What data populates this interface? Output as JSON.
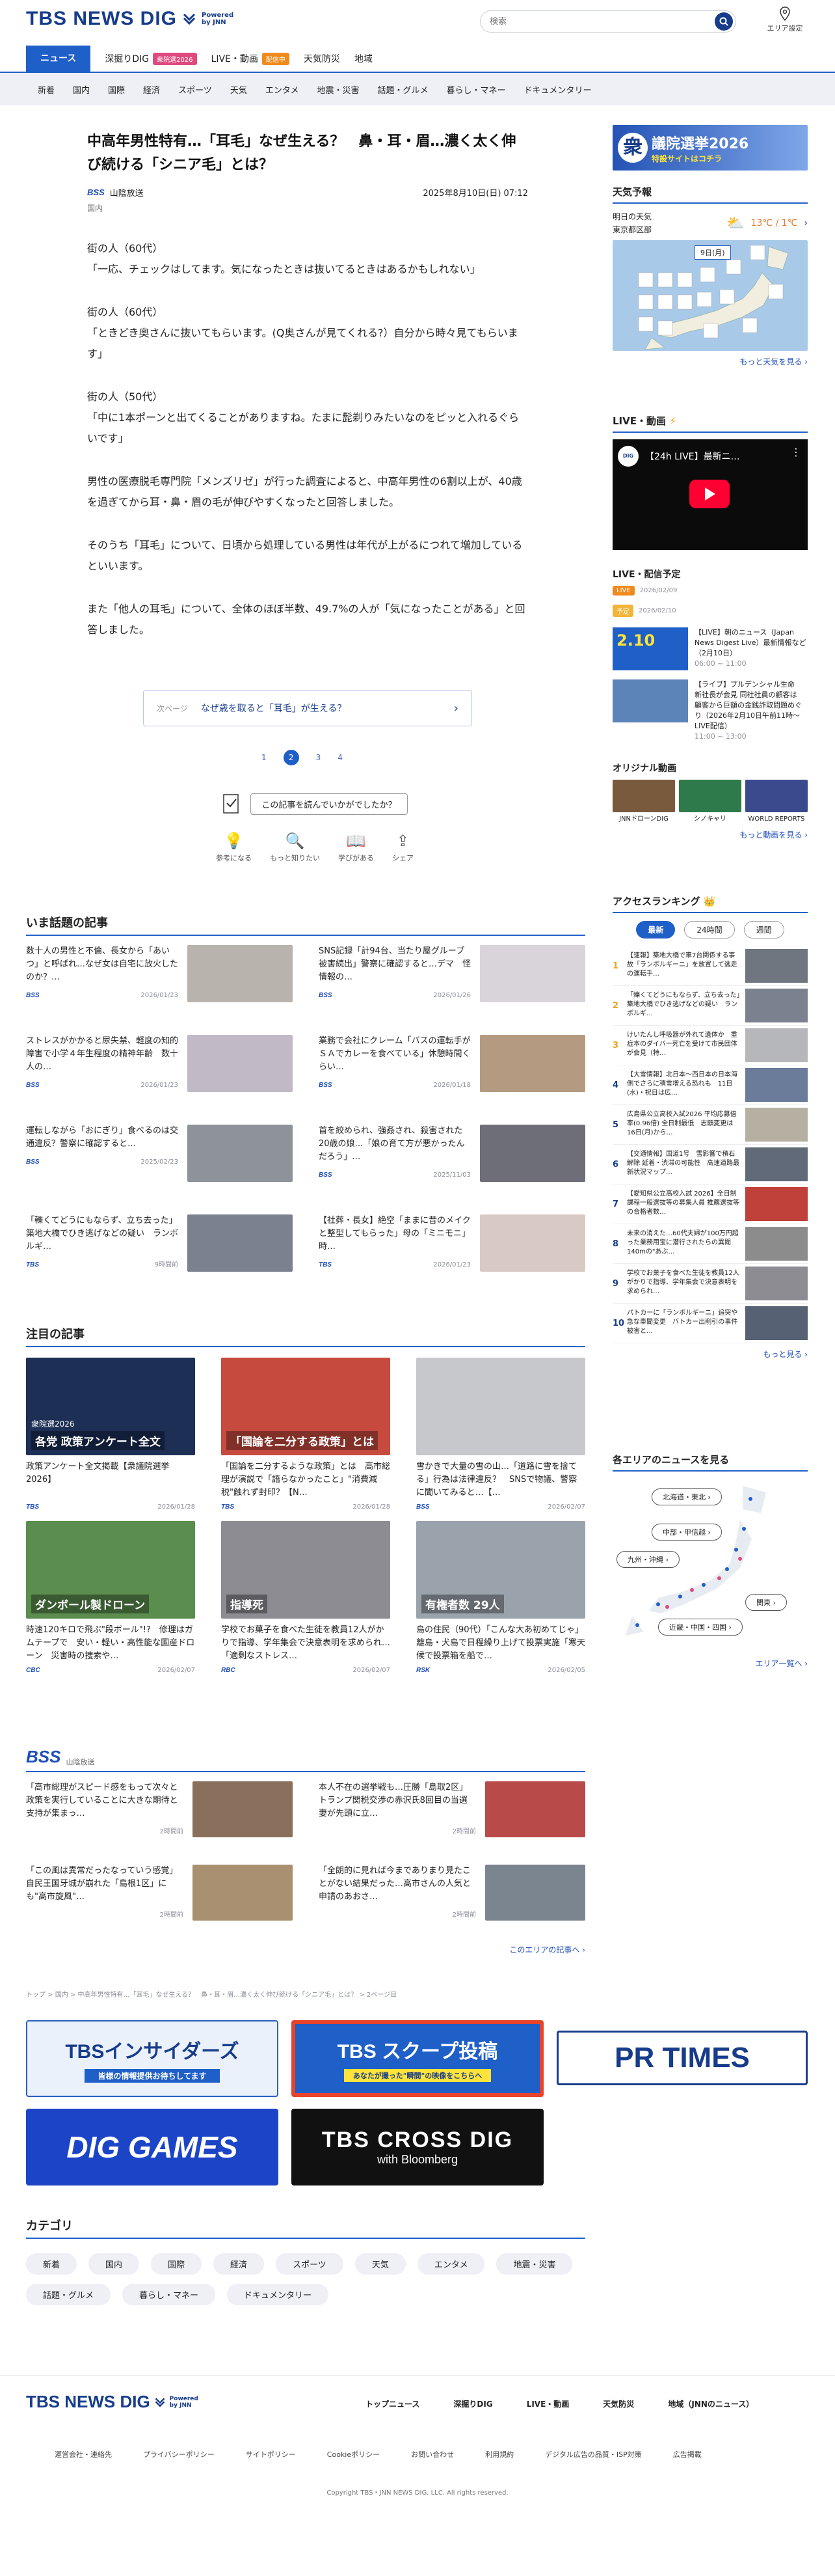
{
  "header": {
    "logo": "TBS NEWS DIG",
    "powered": "Powered",
    "by": "by JNN",
    "search_placeholder": "検索",
    "area_label": "エリア設定"
  },
  "nav_main": [
    {
      "label": "ニュース",
      "active": true
    },
    {
      "label": "深掘りDIG",
      "tag": "衆院選2026",
      "tag_color": "#e0497e"
    },
    {
      "label": "LIVE・動画",
      "tag": "配信中",
      "tag_color": "#f08a1c"
    },
    {
      "label": "天気防災"
    },
    {
      "label": "地域"
    }
  ],
  "nav_sub": [
    "新着",
    "国内",
    "国際",
    "経済",
    "スポーツ",
    "天気",
    "エンタメ",
    "地震・災害",
    "話題・グルメ",
    "暮らし・マネー",
    "ドキュメンタリー"
  ],
  "article": {
    "title": "中高年男性特有…「耳毛」なぜ生える？　鼻・耳・眉…濃く太く伸び続ける「シニア毛」とは？",
    "source_logo": "BSS",
    "source": "山陰放送",
    "date": "2025年8月10日(日) 07:12",
    "category": "国内",
    "paragraphs": [
      "街の人（60代）\n「一応、チェックはしてます。気になったときは抜いてるときはあるかもしれない」",
      "街の人（60代）\n「ときどき奥さんに抜いてもらいます。(Q奥さんが見てくれる?）自分から時々見てもらいます」",
      "街の人（50代）\n「中に1本ポーンと出てくることがありますね。たまに髭剃りみたいなのをピッと入れるぐらいです」",
      "男性の医療脱毛専門院「メンズリゼ」が行った調査によると、中高年男性の6割以上が、40歳を過ぎてから耳・鼻・眉の毛が伸びやすくなったと回答しました。",
      "そのうち「耳毛」について、日頃から処理している男性は年代が上がるにつれて増加しているといいます。",
      "また「他人の耳毛」について、全体のほぼ半数、49.7%の人が「気になったことがある」と回答しました。"
    ],
    "next_label": "次ページ",
    "next_title": "なぜ歳を取ると「耳毛」が生える？",
    "pages": [
      "1",
      "2",
      "3",
      "4"
    ],
    "current_page": "2",
    "rating_question": "この記事を読んでいかがでしたか？",
    "rating_buttons": [
      "参考になる",
      "もっと知りたい",
      "学びがある",
      "シェア"
    ]
  },
  "trending": {
    "title": "いま話題の記事",
    "items": [
      {
        "text": "数十人の男性と不倫、長女から「あいつ」と呼ばれ…なぜ女は自宅に放火したのか？…",
        "src": "BSS",
        "date": "2026/01/23",
        "thumb": "#b9b3ad"
      },
      {
        "text": "SNS記録「計94台、当たり屋グループ被害続出」警察に確認すると…デマ　怪情報の…",
        "src": "BSS",
        "date": "2026/01/26",
        "thumb": "#d8d4d9"
      },
      {
        "text": "ストレスがかかると尿失禁、軽度の知的障害で小学４年生程度の精神年齢　数十人の…",
        "src": "BSS",
        "date": "2026/01/23",
        "thumb": "#c2b9c6"
      },
      {
        "text": "業務で会社にクレーム「バスの運転手がＳＡでカレーを食べている」休憩時間くらい…",
        "src": "BSS",
        "date": "2026/01/18",
        "thumb": "#b59a82"
      },
      {
        "text": "運転しながら「おにぎり」食べるのは交通違反？警察に確認すると…",
        "src": "BSS",
        "date": "2025/02/23",
        "thumb": "#8e9299"
      },
      {
        "text": "首を絞められ、強姦され、殺害された20歳の娘…「娘の育て方が悪かったんだろう」…",
        "src": "BSS",
        "date": "2025/11/03",
        "thumb": "#6d6e77"
      },
      {
        "text": "「轢くてどうにもならず、立ち去った」築地大橋でひき逃げなどの疑い　ランボルギ…",
        "src": "TBS",
        "date": "9時間前",
        "thumb": "#7c8190"
      },
      {
        "text": "【社葬・長女】絶空「ままに昔のメイクと整型してもらった」母の「ミニモニ」時…",
        "src": "TBS",
        "date": "2026/01/23",
        "thumb": "#d9c9c4"
      }
    ]
  },
  "featured": {
    "title": "注目の記事",
    "items": [
      {
        "text": "政策アンケート全文掲載【衆議院選挙2026】",
        "src": "TBS",
        "date": "2026/01/28",
        "thumb": "#1d2f55",
        "label": "各党 政策アンケート全文",
        "sublabel": "衆院選2026"
      },
      {
        "text": "「国論を二分するような政策」とは　高市総理が演説で「語らなかったこと」\"消費減税\"触れず封印？【N…",
        "src": "TBS",
        "date": "2026/01/28",
        "thumb": "#c64a3e",
        "label": "「国論を二分する政策」とは"
      },
      {
        "text": "雪かきで大量の雪の山…「道路に雪を捨てる」行為は法律違反？　SNSで物議、警察に聞いてみると…【…",
        "src": "BSS",
        "date": "2026/02/07",
        "thumb": "#c6c8cc"
      },
      {
        "text": "時速120キロで飛ぶ\"段ボール\"!?　修理はガムテープで　安い・軽い・高性能な国産ドローン　災害時の捜索や…",
        "src": "CBC",
        "date": "2026/02/07",
        "thumb": "#5a8d4e",
        "label": "ダンボール製ドローン"
      },
      {
        "text": "学校でお菓子を食べた生徒を教員12人がかりで指導、学年集会で決意表明を求められ…「適剰なストレス…",
        "src": "RBC",
        "date": "2026/02/07",
        "thumb": "#8c8c92",
        "label": "指導死"
      },
      {
        "text": "島の住民（90代）「こんな大あ初めてじゃ」離島・犬島で日程繰り上げて投票実施「寒天候で投票箱を船で…",
        "src": "RSK",
        "date": "2026/02/05",
        "thumb": "#9aa3ac",
        "label": "有権者数 29人"
      }
    ]
  },
  "bss": {
    "logo": "BSS",
    "name": "山陰放送",
    "items": [
      {
        "text": "「高市総理がスピード感をもって次々と政策を実行していることに大きな期待と支持が集まっ…",
        "date": "2時間前",
        "thumb": "#8a6f5d"
      },
      {
        "text": "本人不在の選挙戦も…圧勝「島取2区」トランプ関税交渉の赤沢氏8回目の当選　妻が先頭に立…",
        "date": "2時間前",
        "thumb": "#b84a4a"
      },
      {
        "text": "「この風は異常だったなっていう感覚」自民王国牙城が崩れた「島根1区」にも\"高市旋風\"…",
        "date": "2時間前",
        "thumb": "#a89070"
      },
      {
        "text": "「全朗的に見れば今までありまり見たことがない結果だった…高市さんの人気と申請のあおさ…",
        "date": "2時間前",
        "thumb": "#7b8590"
      }
    ],
    "more": "このエリアの記事へ ›"
  },
  "breadcrumb": "トップ > 国内 > 中高年男性特有…「耳毛」なぜ生える？　鼻・耳・眉…濃く太く伸び続ける「シニア毛」とは？ > 2ページ目",
  "banners": [
    {
      "label": "TBSインサイダーズ",
      "sub": "皆様の情報提供お待ちしてます"
    },
    {
      "label": "TBS スクープ投稿",
      "sub": "あなたが撮った\"瞬間\"の映像をこちらへ"
    },
    {
      "label": "PR TIMES"
    },
    {
      "label": "DIG GAMES"
    },
    {
      "label": "TBS CROSS DIG",
      "sub": "with Bloomberg"
    }
  ],
  "categories": {
    "title": "カテゴリ",
    "items": [
      "新着",
      "国内",
      "国際",
      "経済",
      "スポーツ",
      "天気",
      "エンタメ",
      "地震・災害",
      "話題・グルメ",
      "暮らし・マネー",
      "ドキュメンタリー"
    ]
  },
  "sidebar": {
    "election_banner": "議院選挙2026",
    "election_prefix": "衆",
    "election_sub": "特設サイトはコチラ",
    "weather": {
      "title": "天気予報",
      "when": "明日の天気",
      "where": "東京都区部",
      "date": "9日(月)",
      "temp": "13℃ / 1℃",
      "more": "もっと天気を見る ›"
    },
    "live": {
      "title": "LIVE・動画",
      "player_title": "【24h LIVE】最新ニ…"
    },
    "schedule": {
      "title": "LIVE・配信予定",
      "rows": [
        {
          "badge": "LIVE",
          "date": "2026/02/09",
          "text": ""
        },
        {
          "badge": "予定",
          "date": "2026/02/10",
          "text": ""
        },
        {
          "badge": "",
          "date": "",
          "text": "【LIVE】朝のニュース（Japan News Digest Live）最新情報など（2月10日）",
          "time": "06:00 ~ 11:00",
          "badge_text": "2.10"
        },
        {
          "badge": "",
          "date": "",
          "text": "【ライブ】プルデンシャル生命　新社長が会見 同社社員の顧客は　顧客から巨額の金銭詐取問題めぐり（2026年2月10日午前11時〜LIVE配信）",
          "time": "11:00 ~ 13:00"
        }
      ]
    },
    "original": {
      "title": "オリジナル動画",
      "items": [
        "JNNドローンDIG",
        "シノキャリ",
        "WORLD REPORTS"
      ],
      "more": "もっと動画を見る ›"
    },
    "ranking": {
      "title": "アクセスランキング",
      "tabs": [
        "最新",
        "24時間",
        "週間"
      ],
      "items": [
        "【速報】築地大橋で車7台関係する事故「ランボルギーニ」を放置して逃走の運転手…",
        "「轢くてどうにもならず、立ち去った」築地大橋でひき逃げなどの疑い　ランボルギ…",
        "けいたんし呼吸器が外れて遺体か　重症本のダイバー死亡を受けて市民団体が会見（特…",
        "【大雪情報】北日本〜西日本の日本海側でさらに積雪増える恐れも　11日(水)・祝日は広…",
        "広島県公立高校入試2026 平均応募倍率(0.96倍) 全日制最低　志願変更は16日(月)から…",
        "【交通情報】国道1号　雪影響で積石解除 延着・渋滞の可能性　高速道路最新状況マップ…",
        "【愛知県公立高校入試 2026】全日制課程一般選抜等の募集人員 推薦選抜等の合格者数…",
        "未来の消えた…60代夫婦が100万円超った業務用宝に潜行されたらの異聞　140mの\"あぶ…",
        "学校でお菓子を食べた生徒を教員12人がかりで指導、学年集会で決意表明を求められ…",
        "パトカーに「ランボルギーニ」追突や急な車間変更　バトカー出削引の事件被害と…"
      ],
      "thumbs": [
        "#6f7680",
        "#7c8190",
        "#b5b7bb",
        "#6a7c9a",
        "#b6b0a2",
        "#606a78",
        "#c0403a",
        "#8d8c8c",
        "#8c8c92",
        "#566173"
      ],
      "more": "もっと見る ›"
    },
    "areas": {
      "title": "各エリアのニュースを見る",
      "buttons": [
        "北海道・東北 ›",
        "中部・甲信越 ›",
        "九州・沖縄 ›",
        "関東 ›",
        "近畿・中国・四国 ›"
      ],
      "more": "エリア一覧へ ›"
    }
  },
  "footer": {
    "logo": "TBS NEWS DIG",
    "powered": "Powered",
    "by": "by JNN",
    "nav": [
      "トップニュース",
      "深掘りDIG",
      "LIVE・動画",
      "天気防災",
      "地域（JNNのニュース）"
    ],
    "links": [
      "運営会社・連絡先",
      "プライバシーポリシー",
      "サイトポリシー",
      "Cookieポリシー",
      "お問い合わせ",
      "利用規約",
      "デジタル広告の品質・ISP対策",
      "広告掲載"
    ],
    "copyright": "Copyright TBS・JNN NEWS DIG, LLC. All rights reserved."
  },
  "colors": {
    "brand": "#173c8b",
    "accent": "#1f5fc8",
    "nav_bg": "#eef0f5"
  }
}
